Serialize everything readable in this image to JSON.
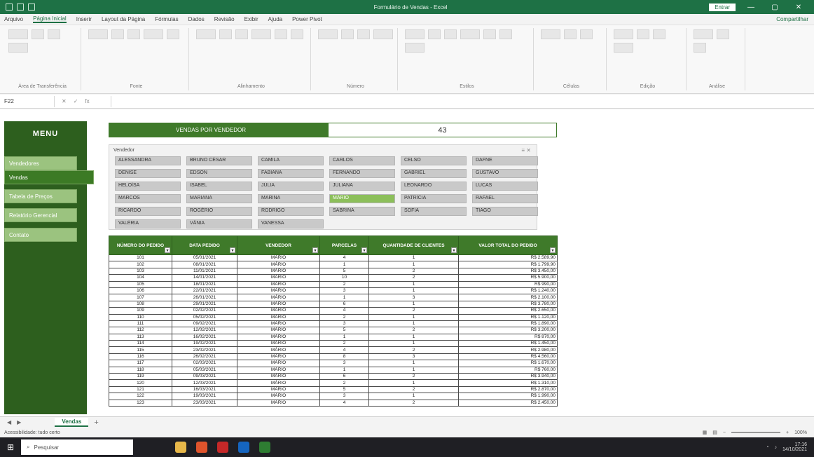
{
  "window": {
    "title": "Formulário de Vendas - Excel",
    "signin": "Entrar"
  },
  "menu": {
    "tabs": [
      "Arquivo",
      "Página Inicial",
      "Inserir",
      "Layout da Página",
      "Fórmulas",
      "Dados",
      "Revisão",
      "Exibir",
      "Ajuda",
      "Power Pivot"
    ],
    "share": "Compartilhar"
  },
  "ribbon": {
    "groups": [
      "Área de Transferência",
      "Fonte",
      "Alinhamento",
      "Número",
      "Estilos",
      "Células",
      "Edição",
      "Análise"
    ]
  },
  "formula_bar": {
    "name_box": "F22",
    "fx": "fx"
  },
  "sidebar": {
    "title": "MENU",
    "items": [
      "Vendedores",
      "Vendas",
      "Tabela de Preços",
      "Relatório Gerencial",
      "Contato"
    ],
    "active_index": 1
  },
  "panel": {
    "tab_label": "VENDAS POR VENDEDOR",
    "value": "43"
  },
  "filter": {
    "label": "Vendedor",
    "icons": "≡ ✕",
    "chips": [
      "ALESSANDRA",
      "BRUNO CÉSAR",
      "CAMILA",
      "CARLOS",
      "CELSO",
      "DAFNE",
      "DENISE",
      "EDSON",
      "FABIANA",
      "FERNANDO",
      "GABRIEL",
      "GUSTAVO",
      "HELOÍSA",
      "ISABEL",
      "JÚLIA",
      "JULIANA",
      "LEONARDO",
      "LUCAS",
      "MARCOS",
      "MARIANA",
      "MARINA",
      "MÁRIO",
      "PATRÍCIA",
      "RAFAEL",
      "RICARDO",
      "ROGÉRIO",
      "RODRIGO",
      "SABRINA",
      "SOFIA",
      "TIAGO",
      "VALÉRIA",
      "VÂNIA",
      "VANESSA"
    ],
    "selected_index": 21
  },
  "table": {
    "headers": [
      "NÚMERO DO PEDIDO",
      "DATA PEDIDO",
      "VENDEDOR",
      "PARCELAS",
      "QUANTIDADE DE CLIENTES",
      "VALOR TOTAL DO PEDIDO"
    ],
    "rows": [
      [
        "101",
        "05/01/2021",
        "MÁRIO",
        "4",
        "1",
        "R$ 2.589,90"
      ],
      [
        "102",
        "08/01/2021",
        "MÁRIO",
        "1",
        "1",
        "R$ 1.799,90"
      ],
      [
        "103",
        "11/01/2021",
        "MÁRIO",
        "5",
        "2",
        "R$ 3.450,00"
      ],
      [
        "104",
        "14/01/2021",
        "MÁRIO",
        "10",
        "2",
        "R$ 5.900,00"
      ],
      [
        "105",
        "18/01/2021",
        "MÁRIO",
        "2",
        "1",
        "R$ 990,00"
      ],
      [
        "106",
        "22/01/2021",
        "MÁRIO",
        "3",
        "1",
        "R$ 1.240,00"
      ],
      [
        "107",
        "26/01/2021",
        "MÁRIO",
        "1",
        "3",
        "R$ 2.100,00"
      ],
      [
        "108",
        "29/01/2021",
        "MÁRIO",
        "6",
        "1",
        "R$ 3.780,00"
      ],
      [
        "109",
        "02/02/2021",
        "MÁRIO",
        "4",
        "2",
        "R$ 2.650,00"
      ],
      [
        "110",
        "05/02/2021",
        "MÁRIO",
        "2",
        "1",
        "R$ 1.120,00"
      ],
      [
        "111",
        "09/02/2021",
        "MÁRIO",
        "3",
        "1",
        "R$ 1.890,00"
      ],
      [
        "112",
        "12/02/2021",
        "MÁRIO",
        "5",
        "2",
        "R$ 3.200,00"
      ],
      [
        "113",
        "16/02/2021",
        "MÁRIO",
        "1",
        "1",
        "R$ 870,00"
      ],
      [
        "114",
        "19/02/2021",
        "MÁRIO",
        "2",
        "1",
        "R$ 1.450,00"
      ],
      [
        "115",
        "23/02/2021",
        "MÁRIO",
        "4",
        "2",
        "R$ 2.980,00"
      ],
      [
        "116",
        "26/02/2021",
        "MÁRIO",
        "8",
        "3",
        "R$ 4.560,00"
      ],
      [
        "117",
        "02/03/2021",
        "MÁRIO",
        "3",
        "1",
        "R$ 1.670,00"
      ],
      [
        "118",
        "05/03/2021",
        "MÁRIO",
        "1",
        "1",
        "R$ 760,00"
      ],
      [
        "119",
        "09/03/2021",
        "MÁRIO",
        "6",
        "2",
        "R$ 3.940,00"
      ],
      [
        "120",
        "12/03/2021",
        "MÁRIO",
        "2",
        "1",
        "R$ 1.310,00"
      ],
      [
        "121",
        "16/03/2021",
        "MÁRIO",
        "5",
        "2",
        "R$ 2.870,00"
      ],
      [
        "122",
        "19/03/2021",
        "MÁRIO",
        "3",
        "1",
        "R$ 1.990,00"
      ],
      [
        "123",
        "23/03/2021",
        "MÁRIO",
        "4",
        "2",
        "R$ 2.450,00"
      ]
    ]
  },
  "sheet_tabs": {
    "active": "Vendas",
    "add": "+"
  },
  "status": {
    "left": "Acessibilidade: tudo certo",
    "zoom": "100%"
  },
  "taskbar": {
    "search": "Pesquisar",
    "time": "17:16",
    "date": "14/10/2021"
  },
  "colors": {
    "excel_green": "#1e7145",
    "sidebar_green": "#2d5f1e",
    "header_green": "#3f7a2a",
    "chip_selected": "#8cbf5a"
  }
}
